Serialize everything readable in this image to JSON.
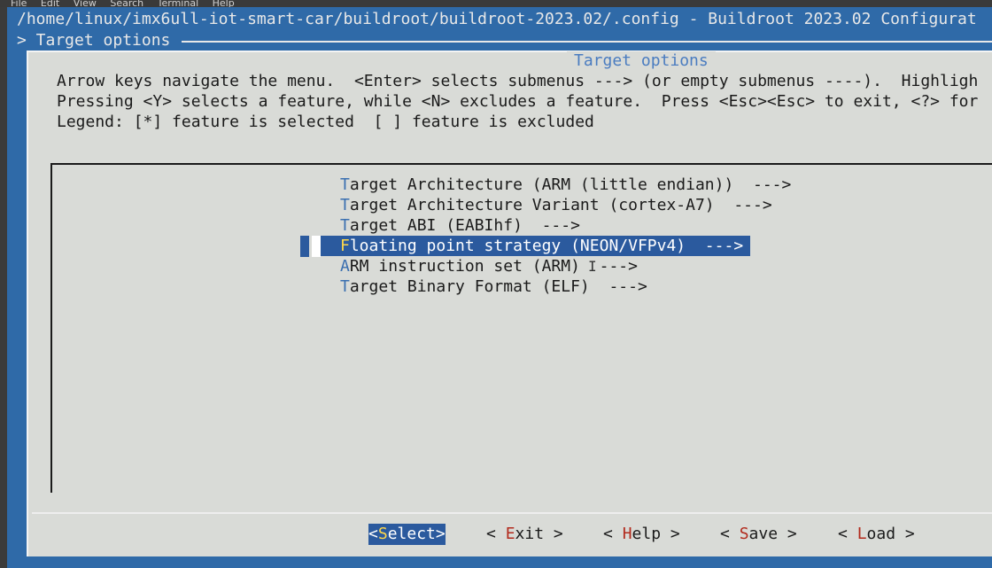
{
  "menubar": {
    "items": [
      "File",
      "Edit",
      "View",
      "Search",
      "Terminal",
      "Help"
    ]
  },
  "terminal": {
    "title": "/home/linux/imx6ull-iot-smart-car/buildroot/buildroot-2023.02/.config - Buildroot 2023.02 Configurat",
    "breadcrumb": "> Target options"
  },
  "dialog": {
    "title": "Target options",
    "help_lines": [
      "Arrow keys navigate the menu.  <Enter> selects submenus ---> (or empty submenus ----).  Highligh",
      "Pressing <Y> selects a feature, while <N> excludes a feature.  Press <Esc><Esc> to exit, <?> for",
      "Legend: [*] feature is selected  [ ] feature is excluded"
    ]
  },
  "menu": {
    "items": [
      {
        "hot": "T",
        "rest": "arget Architecture (ARM (little endian))  --->"
      },
      {
        "hot": "T",
        "rest": "arget Architecture Variant (cortex-A7)  --->"
      },
      {
        "hot": "T",
        "rest": "arget ABI (EABIhf)  --->"
      },
      {
        "hot": "F",
        "rest": "loating point strategy (NEON/VFPv4)  --->",
        "selected": true
      },
      {
        "hot": "A",
        "rest": "RM instruction set (ARM)  --->"
      },
      {
        "hot": "T",
        "rest": "arget Binary Format (ELF)  --->"
      }
    ]
  },
  "buttons": {
    "select": {
      "pre": "<",
      "hot": "S",
      "post": "elect>"
    },
    "exit": {
      "pre": "< ",
      "hot": "E",
      "post": "xit >"
    },
    "help": {
      "pre": "< ",
      "hot": "H",
      "post": "elp >"
    },
    "save": {
      "pre": "< ",
      "hot": "S",
      "post": "ave >"
    },
    "load": {
      "pre": "< ",
      "hot": "L",
      "post": "oad >"
    }
  }
}
